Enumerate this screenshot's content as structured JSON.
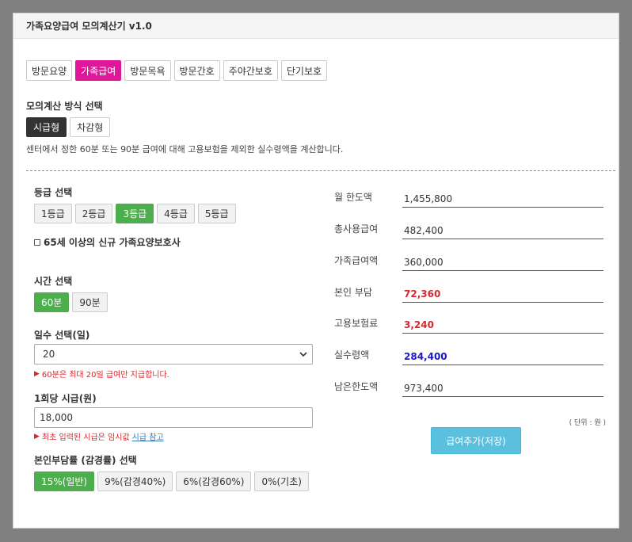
{
  "header": {
    "title": "가족요양급여 모의계산기 v1.0"
  },
  "tabs": [
    {
      "label": "방문요양",
      "active": false
    },
    {
      "label": "가족급여",
      "active": true
    },
    {
      "label": "방문목욕",
      "active": false
    },
    {
      "label": "방문간호",
      "active": false
    },
    {
      "label": "주야간보호",
      "active": false
    },
    {
      "label": "단기보호",
      "active": false
    }
  ],
  "method": {
    "label": "모의계산 방식 선택",
    "options": [
      {
        "label": "시급형",
        "selected": true
      },
      {
        "label": "차감형",
        "selected": false
      }
    ],
    "description": "센터에서 정한 60분 또는 90분 급여에 대해 고용보험을 제외한 실수령액을 계산합니다."
  },
  "grade": {
    "label": "등급 선택",
    "options": [
      "1등급",
      "2등급",
      "3등급",
      "4등급",
      "5등급"
    ],
    "selected": "3등급",
    "checkbox_label": "65세 이상의 신규 가족요양보호사"
  },
  "time": {
    "label": "시간 선택",
    "options": [
      "60분",
      "90분"
    ],
    "selected": "60분"
  },
  "days": {
    "label": "일수 선택(일)",
    "value": "20",
    "note": "60분은 최대 20일 급여만 지급합니다."
  },
  "wage": {
    "label": "1회당 시급(원)",
    "value": "18,000",
    "note": "최초 입력된 시급은 임시값",
    "note_link": "시급 참고"
  },
  "copay": {
    "label": "본인부담률 (감경률) 선택",
    "options": [
      "15%(일반)",
      "9%(감경40%)",
      "6%(감경60%)",
      "0%(기초)"
    ],
    "selected": "15%(일반)"
  },
  "results": [
    {
      "label": "월 한도액",
      "value": "1,455,800",
      "style": "normal"
    },
    {
      "label": "총사용급여",
      "value": "482,400",
      "style": "normal"
    },
    {
      "label": "가족급여액",
      "value": "360,000",
      "style": "normal"
    },
    {
      "label": "본인 부담",
      "value": "72,360",
      "style": "red"
    },
    {
      "label": "고용보험료",
      "value": "3,240",
      "style": "red"
    },
    {
      "label": "실수령액",
      "value": "284,400",
      "style": "blue"
    },
    {
      "label": "남은한도액",
      "value": "973,400",
      "style": "normal"
    }
  ],
  "unit": "( 단위 : 원 )",
  "save_button": "급여추가(저장)",
  "colors": {
    "active_tab": "#e0179a",
    "selected_green": "#4cae4c",
    "save_button": "#5bc0de",
    "red": "#d9272e",
    "blue": "#1a1acc"
  }
}
